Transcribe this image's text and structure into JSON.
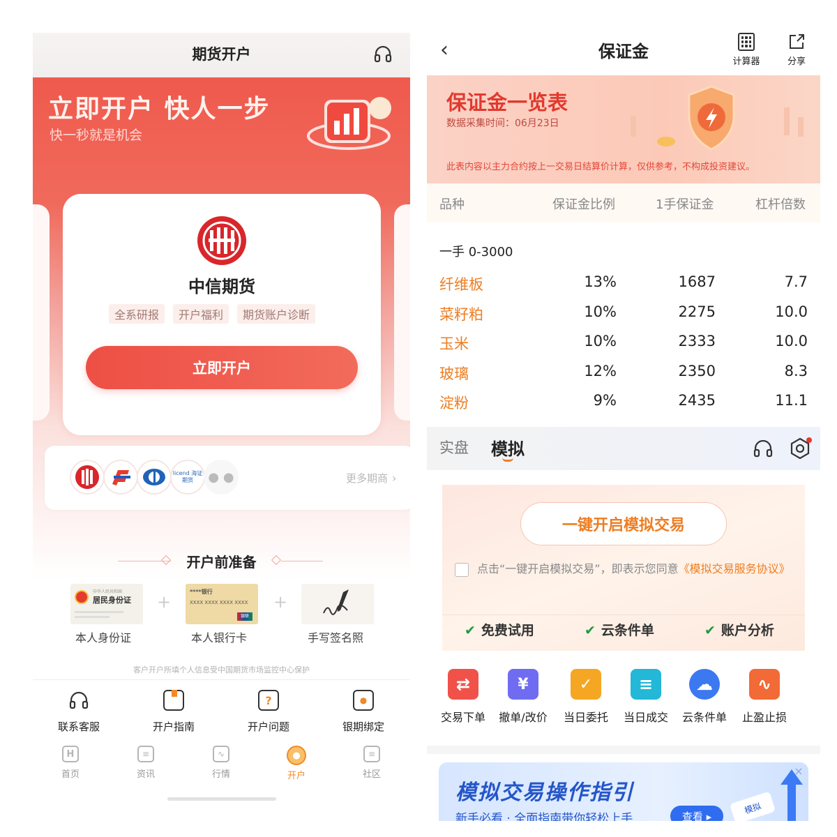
{
  "left": {
    "header": {
      "title": "期货开户"
    },
    "hero": {
      "headline": "立即开户 快人一步",
      "sub": "快一秒就是机会"
    },
    "broker_card": {
      "name": "中信期货",
      "tags": [
        "全系研报",
        "开户福利",
        "期货账户诊断"
      ],
      "cta": "立即开户"
    },
    "brokers_strip": {
      "more_link": "更多期商",
      "logo_text": "licend 海证期货"
    },
    "prep": {
      "title": "开户前准备",
      "items": [
        {
          "label": "本人身份证",
          "doc_small": "中华人民共和国",
          "doc_title": "居民身份证"
        },
        {
          "label": "本人银行卡",
          "doc_small": "****银行",
          "doc_number": "XXXX XXXX XXXX XXXX",
          "doc_badge": "银联"
        },
        {
          "label": "手写签名照"
        }
      ],
      "plus": "+",
      "privacy": "客户开户所填个人信息受中国期货市场监控中心保护"
    },
    "quick_nav": [
      {
        "label": "联系客服"
      },
      {
        "label": "开户指南"
      },
      {
        "label": "开户问题"
      },
      {
        "label": "银期绑定"
      }
    ],
    "tabbar": [
      {
        "label": "首页"
      },
      {
        "label": "资讯"
      },
      {
        "label": "行情"
      },
      {
        "label": "开户",
        "active": true
      },
      {
        "label": "社区"
      }
    ]
  },
  "right": {
    "header": {
      "title": "保证金",
      "calc_label": "计算器",
      "share_label": "分享"
    },
    "banner": {
      "title": "保证金一览表",
      "date": "数据采集时间：06月23日",
      "disclaimer": "此表内容以主力合约按上一交易日结算价计算，仅供参考，不构成投资建议。"
    },
    "table": {
      "headers": [
        "品种",
        "保证金比例",
        "1手保证金",
        "杠杆倍数"
      ],
      "group_label": "一手 0-3000",
      "rows": [
        {
          "name": "纤维板",
          "ratio": "13%",
          "margin": "1687",
          "leverage": "7.7"
        },
        {
          "name": "菜籽粕",
          "ratio": "10%",
          "margin": "2275",
          "leverage": "10.0"
        },
        {
          "name": "玉米",
          "ratio": "10%",
          "margin": "2333",
          "leverage": "10.0"
        },
        {
          "name": "玻璃",
          "ratio": "12%",
          "margin": "2350",
          "leverage": "8.3"
        },
        {
          "name": "淀粉",
          "ratio": "9%",
          "margin": "2435",
          "leverage": "11.1"
        }
      ]
    },
    "tabs": {
      "real": "实盘",
      "sim": "模拟"
    },
    "sim_card": {
      "cta": "一键开启模拟交易",
      "agree_text": "点击“一键开启模拟交易”，即表示您同意",
      "agree_link": "《模拟交易服务协议》",
      "features": [
        "免费试用",
        "云条件单",
        "账户分析"
      ]
    },
    "tools": [
      {
        "label": "交易下单",
        "icon": "exchange-icon",
        "color": "#f0524a",
        "glyph": "⇄"
      },
      {
        "label": "撤单/改价",
        "icon": "yen-icon",
        "color": "#6f6cf2",
        "glyph": "¥"
      },
      {
        "label": "当日委托",
        "icon": "order-icon",
        "color": "#f5a623",
        "glyph": "✓"
      },
      {
        "label": "当日成交",
        "icon": "deal-icon",
        "color": "#23b7d8",
        "glyph": "≡"
      },
      {
        "label": "云条件单",
        "icon": "cloud-icon",
        "color": "#3c78f0",
        "glyph": "☁"
      },
      {
        "label": "止盈止损",
        "icon": "stop-icon",
        "color": "#f26a35",
        "glyph": "∿"
      }
    ],
    "promo": {
      "title": "模拟交易操作指引",
      "sub": "新手必看 · 全面指南带你轻松上手",
      "btn": "查看 ▸",
      "tag": "模拟"
    }
  }
}
